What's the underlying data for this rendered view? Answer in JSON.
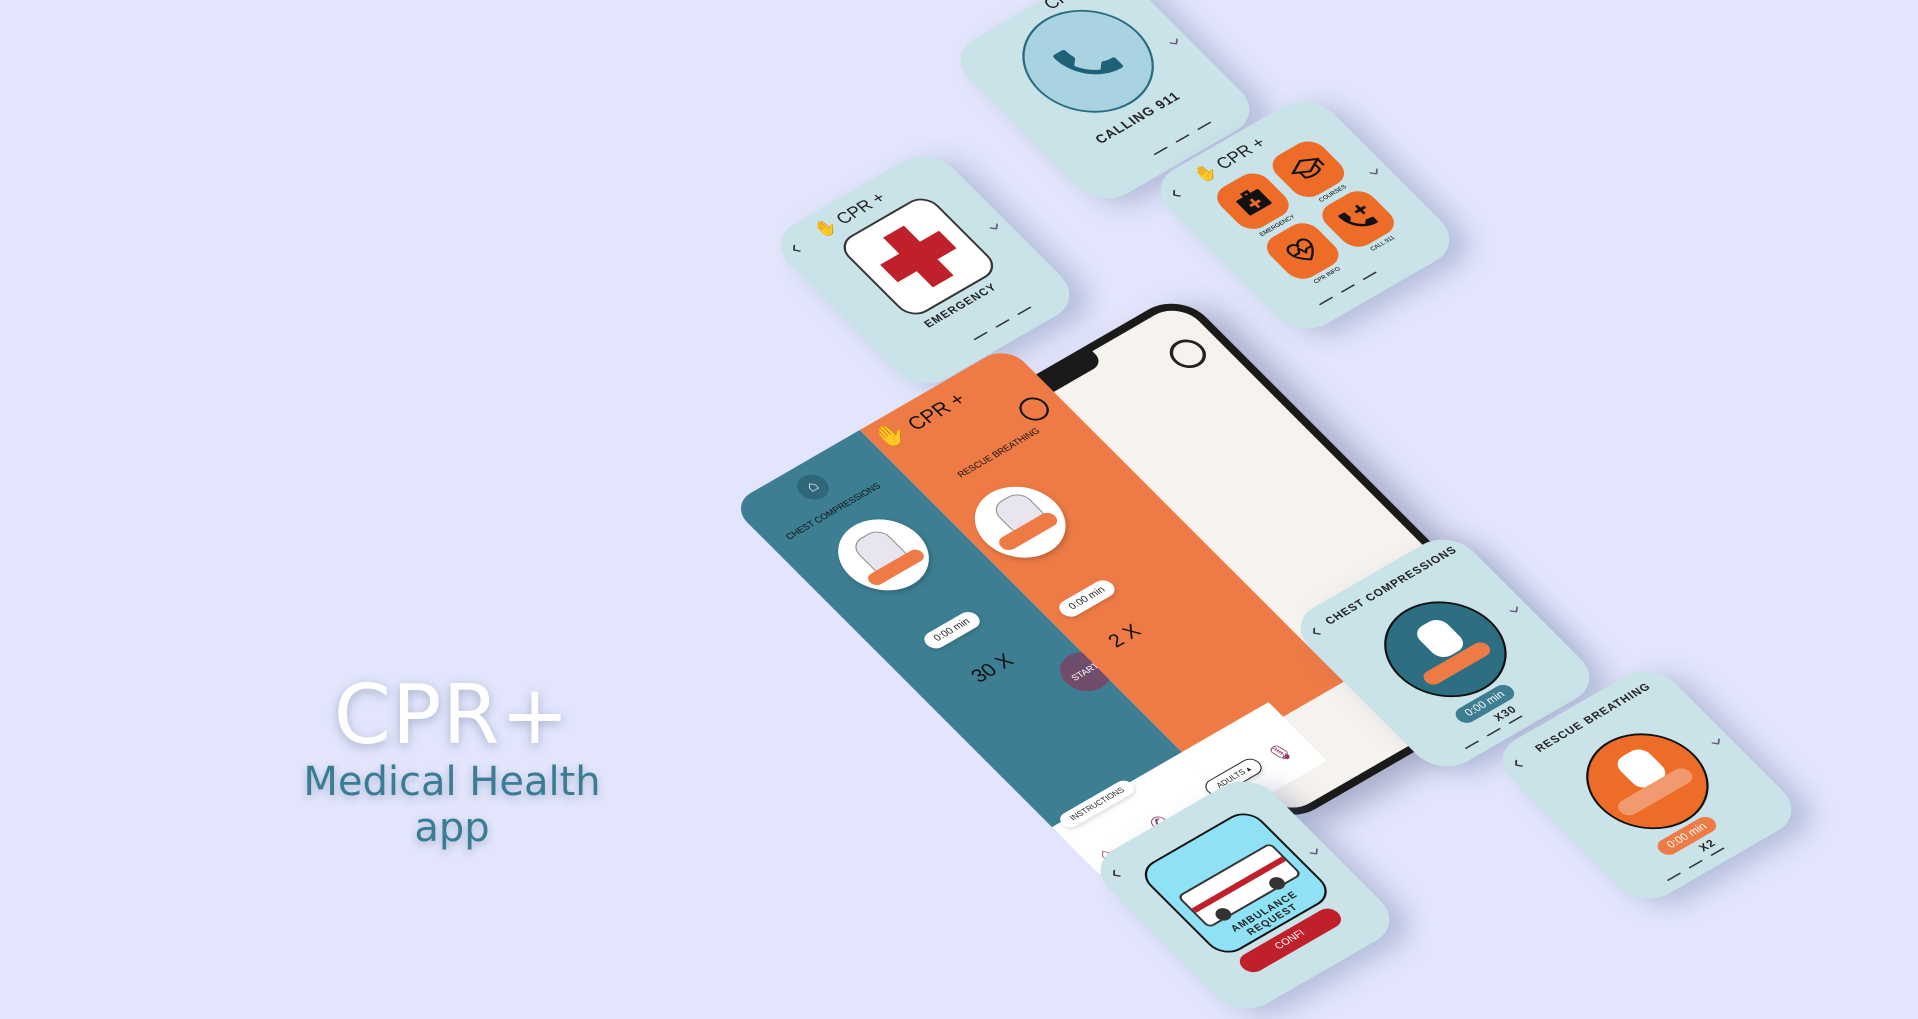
{
  "hero": {
    "title": "CPR+",
    "subtitle": "Medical Health app"
  },
  "brand": "CPR +",
  "watches": {
    "calling": {
      "caption": "CALLING 911"
    },
    "emergency": {
      "caption": "EMERGENCY"
    },
    "menu": {
      "items": [
        "EMERGENCY",
        "COURSES",
        "CPR INFO",
        "CALL 911"
      ]
    },
    "chest": {
      "title": "CHEST COMPRESSIONS",
      "timer": "0:00 min",
      "count": "X30"
    },
    "rescue": {
      "title": "RESCUE BREATHING",
      "timer": "0:00 min",
      "count": "X2"
    },
    "ambulance": {
      "caption": "AMBULANCE REQUEST",
      "button": "CONFI"
    }
  },
  "phone": {
    "left_title": "CHEST COMPRESSIONS",
    "right_title": "RESCUE BREATHING",
    "left_timer": "0:00 min",
    "left_count": "30 X",
    "right_timer": "0:00 min",
    "right_count": "2 X",
    "start": "START",
    "instructions": "INSTRUCTIONS",
    "adults": "ADULTS"
  },
  "colors": {
    "background": "#e2e5fb",
    "watch": "#c9e3e8",
    "teal": "#3d7e93",
    "orange": "#ee7b46",
    "accent_icon": "#ed6d28"
  }
}
